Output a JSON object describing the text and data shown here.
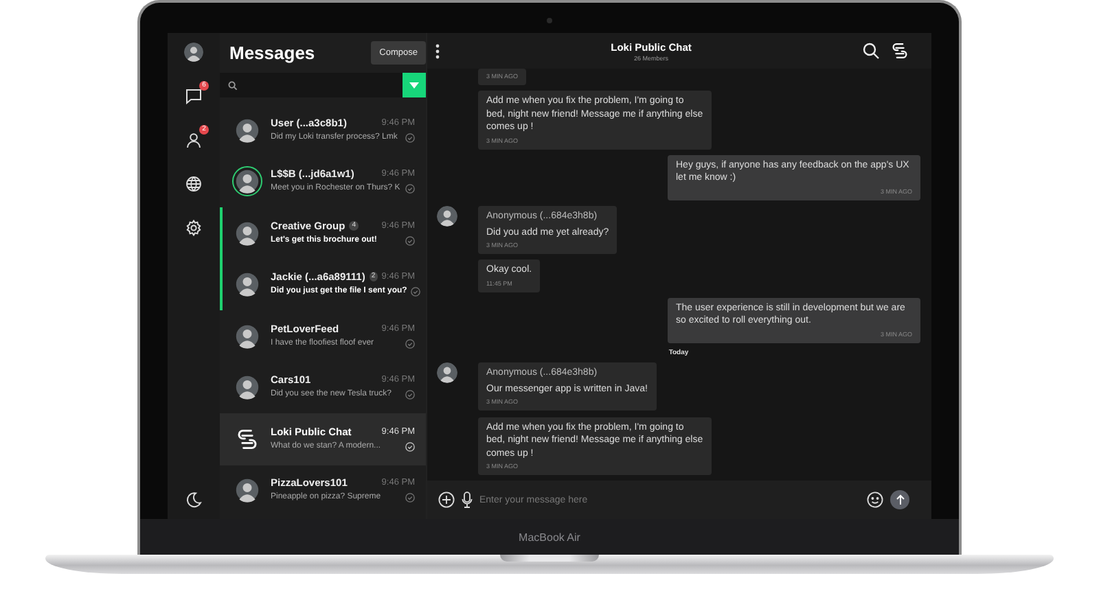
{
  "device": {
    "label": "MacBook Air"
  },
  "rail": {
    "items": [
      {
        "kind": "avatar"
      },
      {
        "kind": "chat",
        "badge": "6"
      },
      {
        "kind": "contacts",
        "badge": "2"
      },
      {
        "kind": "globe"
      },
      {
        "kind": "settings"
      },
      {
        "kind": "moon"
      }
    ]
  },
  "list_header": {
    "title": "Messages",
    "compose": "Compose"
  },
  "conversations": [
    {
      "name": "User (...a3c8b1)",
      "preview": "Did my Loki transfer process? Lmk",
      "time": "9:46 PM",
      "kind": "photo",
      "online": false,
      "unread": false,
      "selected": false
    },
    {
      "name": "L$$B (...jd6a1w1)",
      "preview": "Meet you in Rochester on Thurs? K",
      "time": "9:46 PM",
      "kind": "photo",
      "online": true,
      "unread": false,
      "selected": false
    },
    {
      "name": "Creative Group",
      "count": "4",
      "preview": "Let's get this brochure out!",
      "time": "9:46 PM",
      "kind": "photo",
      "online": false,
      "unread": true,
      "selected": false
    },
    {
      "name": "Jackie (...a6a89111)",
      "count": "2",
      "preview": "Did you just get the file I sent you?",
      "time": "9:46 PM",
      "kind": "photo",
      "online": false,
      "unread": true,
      "selected": false
    },
    {
      "name": "PetLoverFeed",
      "preview": "I have the floofiest floof ever",
      "time": "9:46 PM",
      "kind": "photo",
      "online": false,
      "unread": false,
      "selected": false
    },
    {
      "name": "Cars101",
      "preview": "Did you see the new Tesla truck?",
      "time": "9:46 PM",
      "kind": "photo",
      "online": false,
      "unread": false,
      "selected": false
    },
    {
      "name": "Loki Public Chat",
      "preview": "What do we stan? A modern...",
      "time": "9:46 PM",
      "kind": "logo",
      "online": false,
      "unread": false,
      "selected": true
    },
    {
      "name": "PizzaLovers101",
      "preview": "Pineapple on pizza? Supreme",
      "time": "9:46 PM",
      "kind": "photo",
      "online": false,
      "unread": false,
      "selected": false
    }
  ],
  "chat_header": {
    "title": "Loki Public Chat",
    "subtitle": "26 Members"
  },
  "messages": [
    {
      "kind": "incoming",
      "time": "3 MIN AGO"
    },
    {
      "kind": "incoming",
      "text": "Add me when you fix the problem, I'm going to bed, night new friend! Message me if anything else comes up !",
      "time": "3 MIN AGO"
    },
    {
      "kind": "outgoing",
      "text": "Hey guys, if anyone has any feedback on the app's UX let me know :)",
      "time": "3 MIN AGO"
    },
    {
      "kind": "incoming",
      "sender": "Anonymous (...684e3h8b)",
      "text": "Did you add me yet already?",
      "time": "3 MIN AGO"
    },
    {
      "kind": "incoming",
      "text": "Okay cool.",
      "time": "11:45 PM"
    },
    {
      "kind": "outgoing",
      "text": "The user experience is still in development but we are so excited to roll everything out.",
      "time": "3 MIN AGO"
    },
    {
      "kind": "divider",
      "text": "Today"
    },
    {
      "kind": "incoming",
      "sender": "Anonymous (...684e3h8b)",
      "text": "Our messenger app is written in Java!",
      "time": "3 MIN AGO"
    },
    {
      "kind": "incoming",
      "text": "Add me when you fix the problem, I'm going to bed, night new friend! Message me if anything else comes up !",
      "time": "3 MIN AGO"
    }
  ],
  "composer": {
    "placeholder": "Enter your message here"
  }
}
